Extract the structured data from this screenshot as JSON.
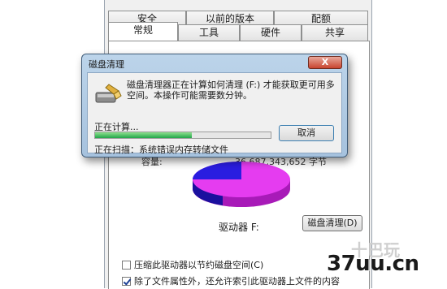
{
  "properties_window": {
    "tabs_row1": [
      "安全",
      "以前的版本",
      "配额"
    ],
    "tabs_row2": [
      "常规",
      "工具",
      "硬件",
      "共享"
    ],
    "capacity_label": "容量:",
    "capacity_value": "36,687,343,652 字节",
    "drive_label": "驱动器 F:",
    "cleanup_button": "磁盘清理(D)",
    "compress_option": "压缩此驱动器以节约磁盘空间(C)",
    "compress_checked": false,
    "index_option": "除了文件属性外，还允许索引此驱动器上文件的内容",
    "index_checked": true,
    "pie_colors": {
      "used": "#2a1de0",
      "free": "#e53cf0"
    }
  },
  "dialog": {
    "title": "磁盘清理",
    "close_label": "X",
    "message": "磁盘清理器正在计算如何清理 (F:) 才能获取更可用多空间。本操作可能需要数分钟。",
    "status": "正在计算...",
    "progress": 0.55,
    "cancel_button": "取消",
    "scan_prefix": "正在扫描：",
    "scan_item": "系统错误内存转储文件"
  },
  "watermark": {
    "text": "37uu.cn",
    "ghost": "十巴玩"
  }
}
